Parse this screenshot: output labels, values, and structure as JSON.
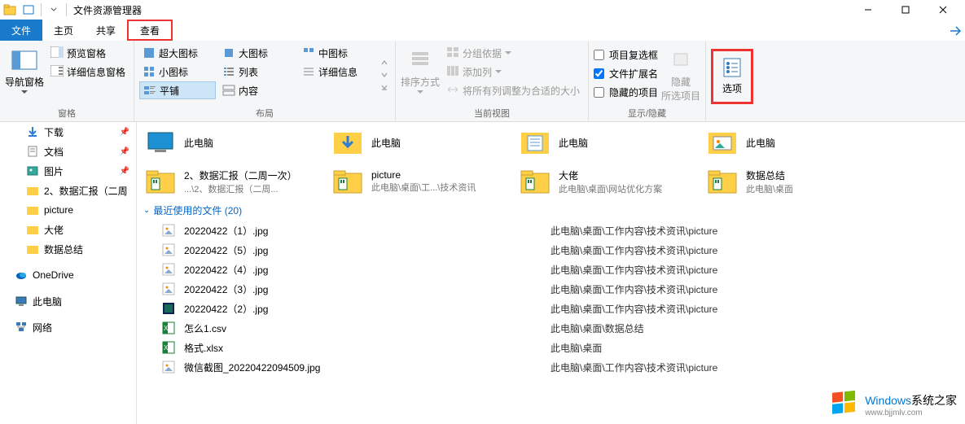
{
  "window": {
    "title": "文件资源管理器"
  },
  "tabs": {
    "file": "文件",
    "home": "主页",
    "share": "共享",
    "view": "查看"
  },
  "ribbon": {
    "panes": {
      "nav": "导航窗格",
      "preview": "预览窗格",
      "details": "详细信息窗格",
      "group": "窗格"
    },
    "layout": {
      "extra_large": "超大图标",
      "large": "大图标",
      "medium": "中图标",
      "small": "小图标",
      "list": "列表",
      "details": "详细信息",
      "tiles": "平铺",
      "content": "内容",
      "group": "布局"
    },
    "currentview": {
      "sort": "排序方式",
      "groupby": "分组依据",
      "addcols": "添加列",
      "autosize": "将所有列调整为合适的大小",
      "group": "当前视图"
    },
    "showhide": {
      "checkboxes": "项目复选框",
      "extensions": "文件扩展名",
      "hidden": "隐藏的项目",
      "hide_selected": "隐藏\n所选项目",
      "group": "显示/隐藏"
    },
    "options": {
      "label": "选项"
    }
  },
  "sidebar": {
    "downloads": "下载",
    "documents": "文档",
    "pictures": "图片",
    "folder1": "2、数据汇报（二周",
    "folder2": "picture",
    "folder3": "大佬",
    "folder4": "数据总结",
    "onedrive": "OneDrive",
    "thispc": "此电脑",
    "network": "网络"
  },
  "folders_row1": [
    {
      "name": "此电脑",
      "sub": "",
      "type": "desktop"
    },
    {
      "name": "此电脑",
      "sub": "",
      "type": "download"
    },
    {
      "name": "此电脑",
      "sub": "",
      "type": "docs"
    },
    {
      "name": "此电脑",
      "sub": "",
      "type": "pics"
    }
  ],
  "folders_row2": [
    {
      "name": "2、数据汇报（二周一次）",
      "sub": "...\\2、数据汇报（二周...",
      "type": "folder"
    },
    {
      "name": "picture",
      "sub": "此电脑\\桌面\\工...\\技术资讯",
      "type": "folder"
    },
    {
      "name": "大佬",
      "sub": "此电脑\\桌面\\网站优化方案",
      "type": "folder"
    },
    {
      "name": "数据总结",
      "sub": "此电脑\\桌面",
      "type": "folder"
    }
  ],
  "recent": {
    "header": "最近使用的文件 (20)",
    "items": [
      {
        "name": "20220422（1）.jpg",
        "path": "此电脑\\桌面\\工作内容\\技术资讯\\picture",
        "type": "jpg"
      },
      {
        "name": "20220422（5）.jpg",
        "path": "此电脑\\桌面\\工作内容\\技术资讯\\picture",
        "type": "jpg"
      },
      {
        "name": "20220422（4）.jpg",
        "path": "此电脑\\桌面\\工作内容\\技术资讯\\picture",
        "type": "jpg"
      },
      {
        "name": "20220422（3）.jpg",
        "path": "此电脑\\桌面\\工作内容\\技术资讯\\picture",
        "type": "jpg"
      },
      {
        "name": "20220422（2）.jpg",
        "path": "此电脑\\桌面\\工作内容\\技术资讯\\picture",
        "type": "jpg2"
      },
      {
        "name": "怎么1.csv",
        "path": "此电脑\\桌面\\数据总结",
        "type": "xls"
      },
      {
        "name": "格式.xlsx",
        "path": "此电脑\\桌面",
        "type": "xls"
      },
      {
        "name": "微信截图_20220422094509.jpg",
        "path": "此电脑\\桌面\\工作内容\\技术资讯\\picture",
        "type": "jpg"
      }
    ]
  },
  "watermark": {
    "brand_pre": "Windows",
    "brand_post": "系统之家",
    "url": "www.bjjmlv.com"
  }
}
